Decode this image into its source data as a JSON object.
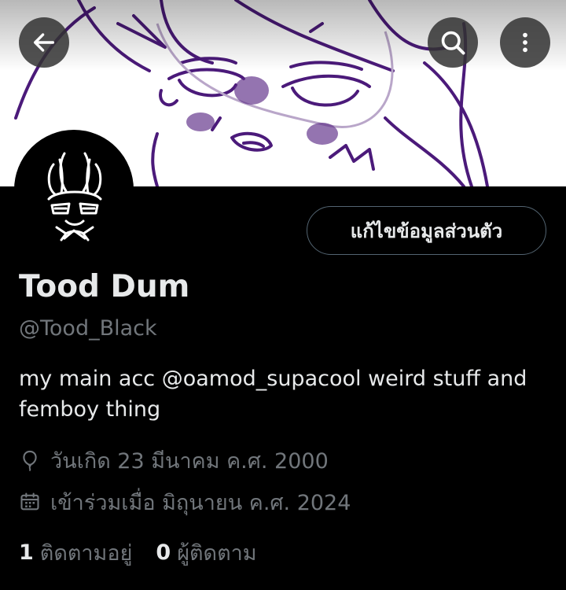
{
  "header": {
    "back_icon": "arrow-left-icon",
    "search_icon": "search-icon",
    "more_icon": "more-vertical-icon",
    "banner_stroke_color": "#4b1a7a"
  },
  "profile": {
    "edit_button_label": "แก้ไขข้อมูลส่วนตัว",
    "display_name": "Tood Dum",
    "handle": "@Tood_Black",
    "bio": "my main acc @oamod_supacool weird stuff and femboy thing",
    "birthday": "วันเกิด 23 มีนาคม ค.ศ. 2000",
    "joined": "เข้าร่วมเมื่อ มิถุนายน ค.ศ. 2024"
  },
  "stats": {
    "following_count": "1",
    "following_label": "ติดตามอยู่",
    "followers_count": "0",
    "followers_label": "ผู้ติดตาม"
  },
  "colors": {
    "background": "#000000",
    "primary_text": "#e7e9ea",
    "secondary_text": "#71767b",
    "border": "#536471"
  }
}
